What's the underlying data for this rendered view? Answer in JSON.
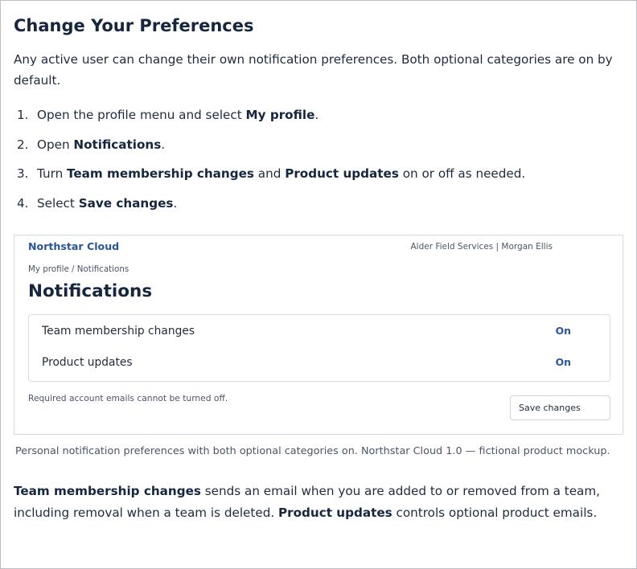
{
  "doc": {
    "title": "Change Your Preferences",
    "intro": "Any active user can change their own notification preferences. Both optional categories are on by default.",
    "steps": [
      {
        "num": "1.",
        "pre": "Open the profile menu and select ",
        "bold": "My profile",
        "post": "."
      },
      {
        "num": "2.",
        "pre": "Open ",
        "bold": "Notifications",
        "post": "."
      },
      {
        "num": "3.",
        "pre": "Turn ",
        "bold": "Team membership changes",
        "mid": " and ",
        "bold2": "Product updates",
        "post": " on or off as needed."
      },
      {
        "num": "4.",
        "pre": "Select ",
        "bold": "Save changes",
        "post": "."
      }
    ],
    "caption": "Personal notification preferences with both optional categories on. Northstar Cloud 1.0 — fictional product mockup.",
    "outro": {
      "bold1": "Team membership changes",
      "text1": " sends an email when you are added to or removed from a team, including removal when a team is deleted. ",
      "bold2": "Product updates",
      "text2": " controls optional product emails."
    }
  },
  "mockup": {
    "brand": "Northstar Cloud",
    "org_user": "Alder Field Services | Morgan Ellis",
    "breadcrumb": "My profile / Notifications",
    "title": "Notifications",
    "preferences": [
      {
        "label": "Team membership changes",
        "state": "On"
      },
      {
        "label": "Product updates",
        "state": "On"
      }
    ],
    "footnote": "Required account emails cannot be turned off.",
    "save_label": "Save changes",
    "accent_color": "#2a5596"
  }
}
